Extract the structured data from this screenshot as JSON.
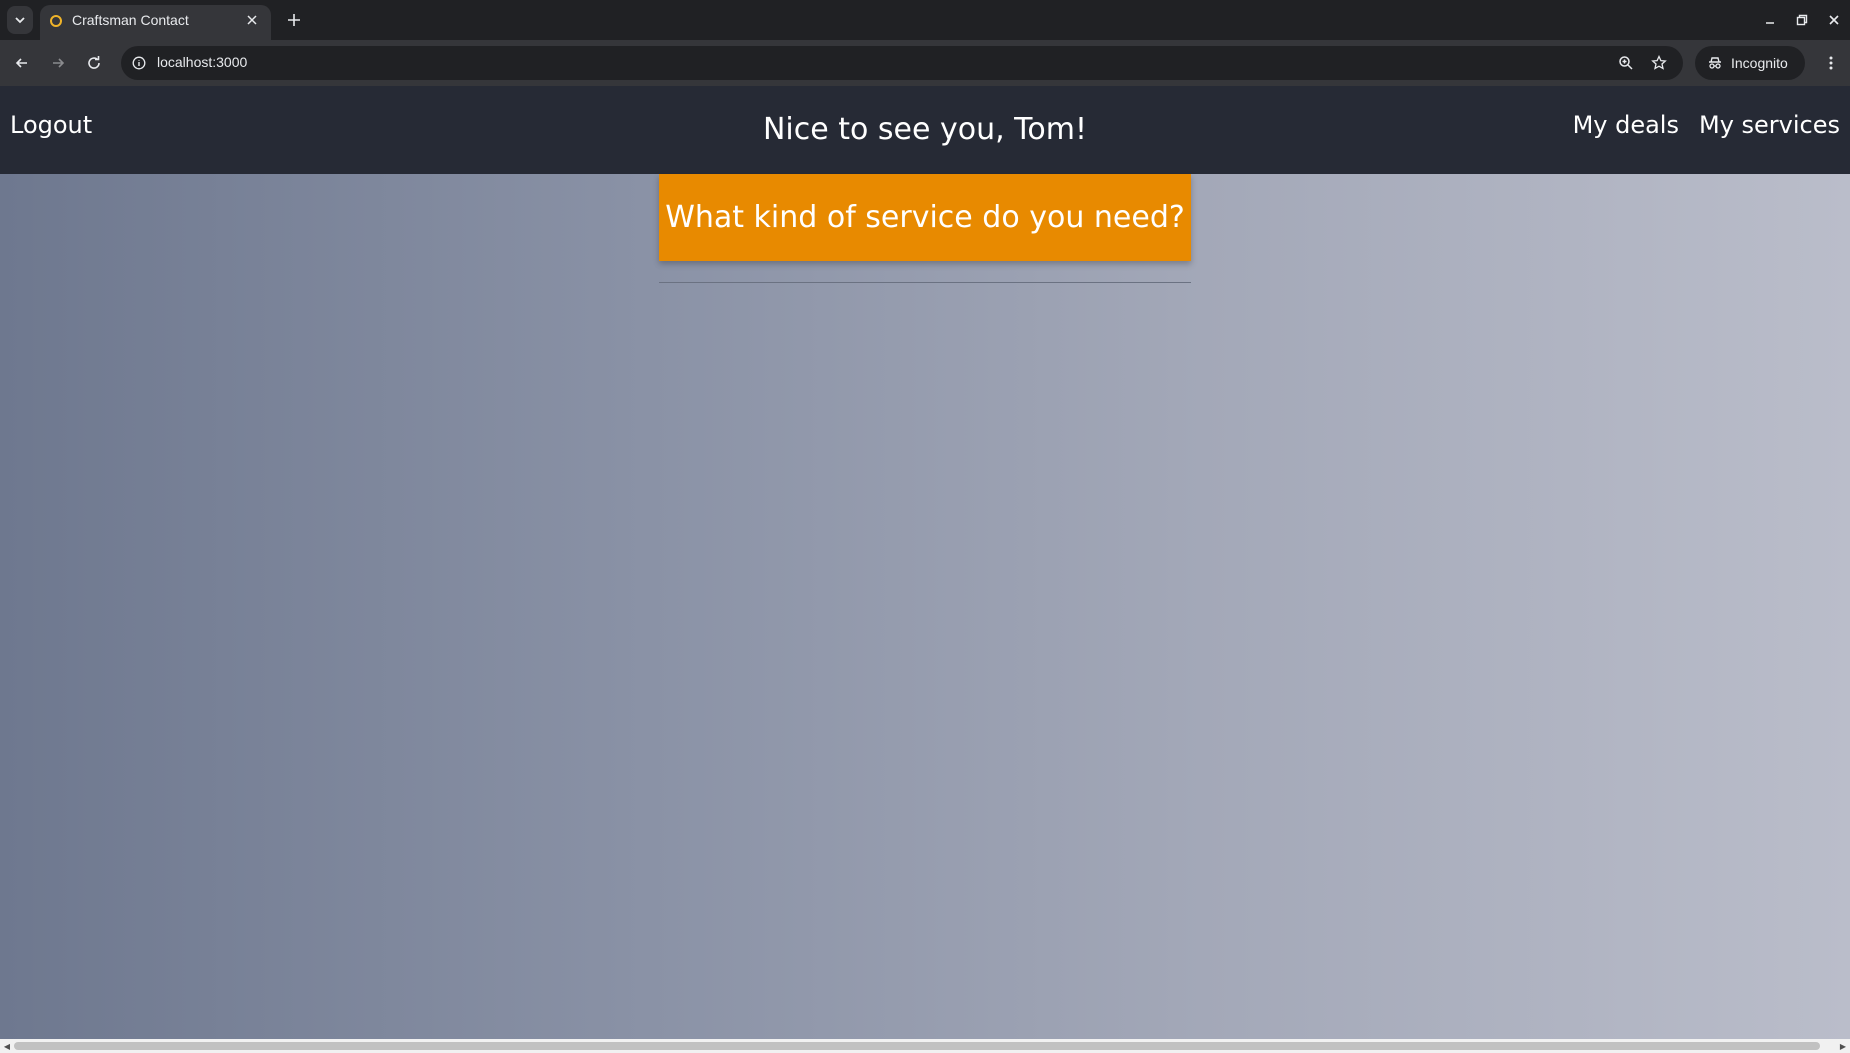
{
  "browser": {
    "tab_title": "Craftsman Contact",
    "url": "localhost:3000",
    "incognito_label": "Incognito"
  },
  "header": {
    "logout_label": "Logout",
    "greeting": "Nice to see you, Tom!",
    "nav": {
      "deals_label": "My deals",
      "services_label": "My services"
    }
  },
  "main": {
    "service_prompt": "What kind of service do you need?"
  },
  "colors": {
    "header_bg": "#262a35",
    "accent": "#e88a00"
  }
}
